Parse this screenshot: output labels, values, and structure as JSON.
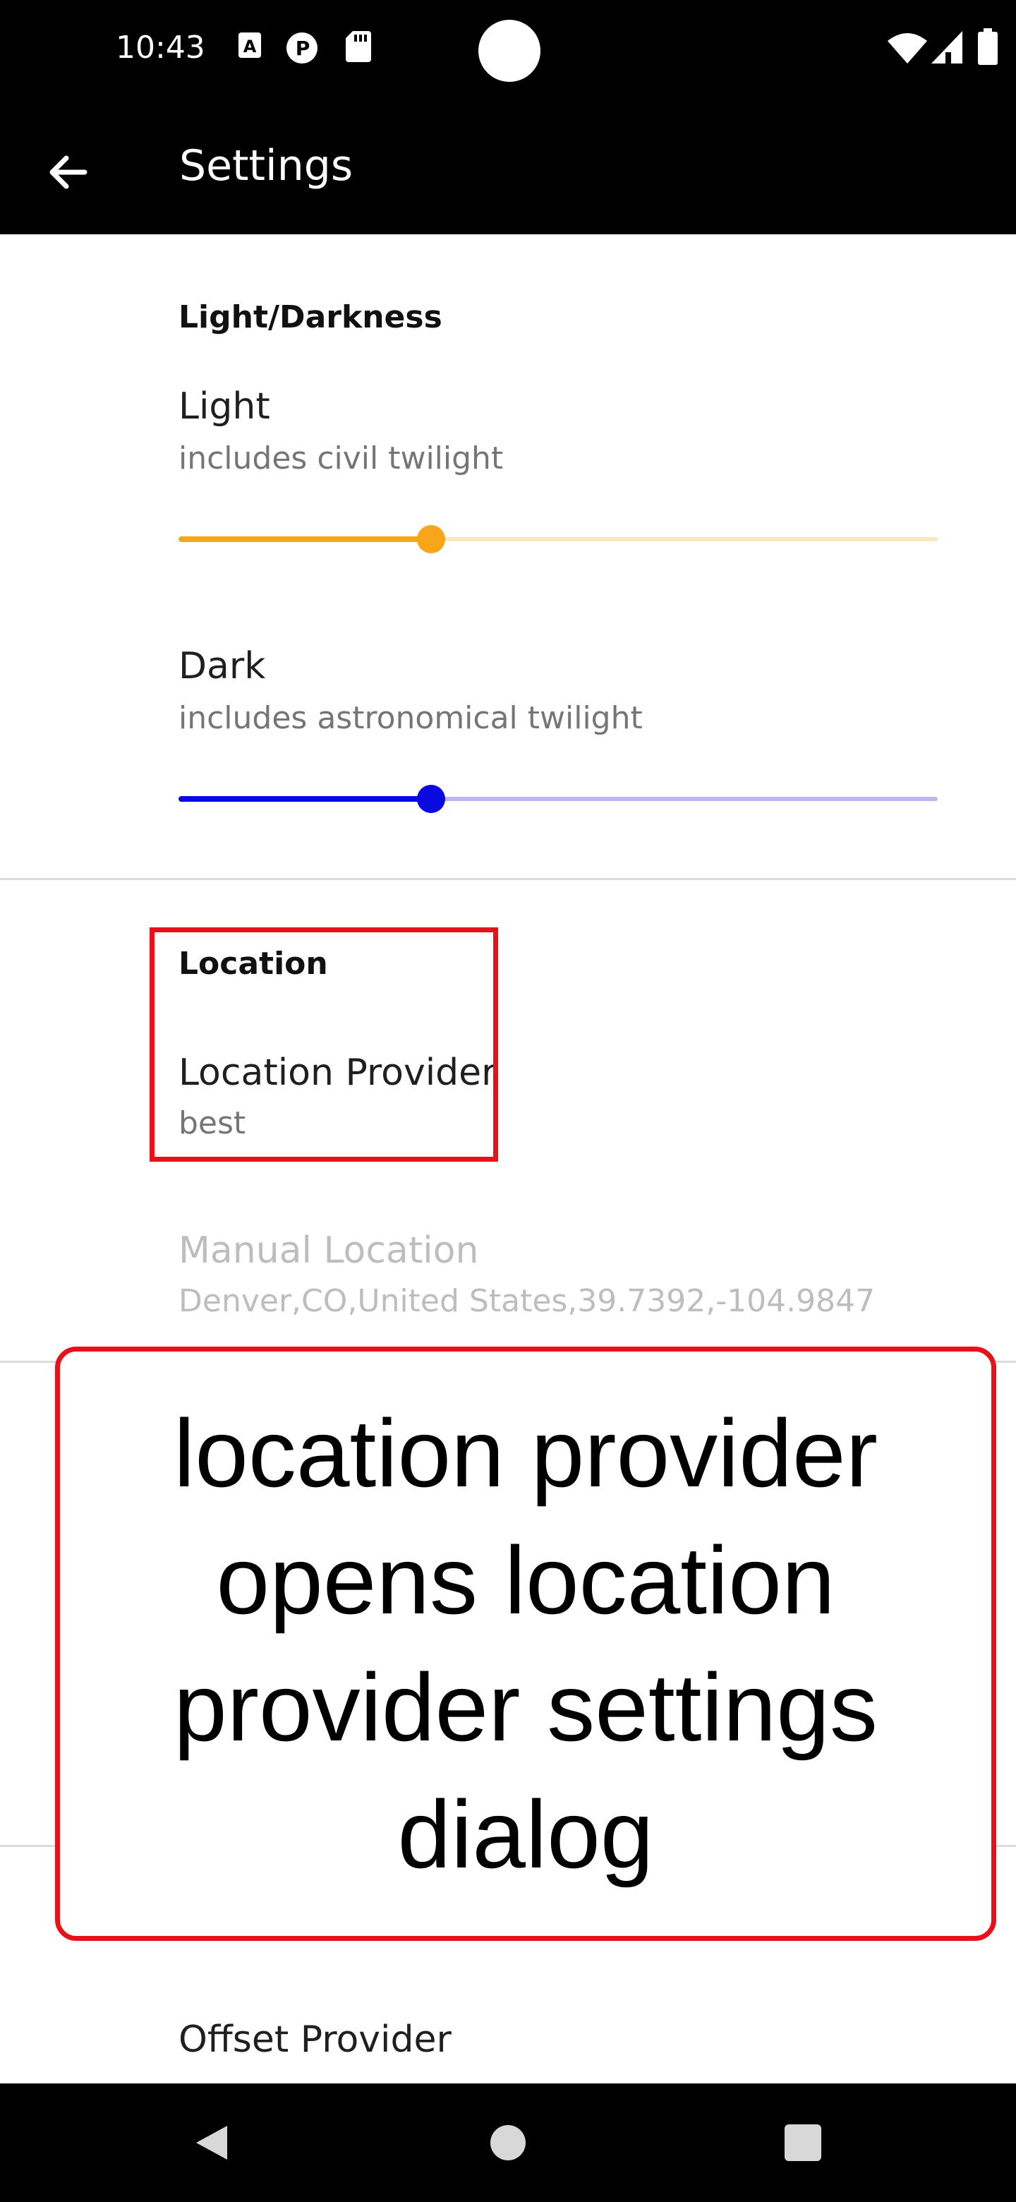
{
  "status_bar": {
    "time": "10:43",
    "left_icons": [
      "a-icon",
      "p-icon",
      "sd-card-icon"
    ],
    "right_icons": [
      "wifi-icon",
      "signal-icon",
      "battery-icon"
    ]
  },
  "app_bar": {
    "title": "Settings",
    "back_icon": "arrow-back-icon"
  },
  "sections": {
    "light_darkness": {
      "header": "Light/Darkness",
      "light": {
        "title": "Light",
        "summary": "includes civil twilight",
        "level": 0.333,
        "color": "#f9a51a",
        "track_color": "#fde6bd"
      },
      "dark": {
        "title": "Dark",
        "summary": "includes astronomical twilight",
        "level": 0.333,
        "color": "#0a0ae0",
        "track_color": "#b9b9f0"
      }
    },
    "location": {
      "header": "Location",
      "provider": {
        "title": "Location Provider",
        "summary": "best"
      },
      "manual": {
        "title": "Manual Location",
        "summary": "Denver,CO,United States,39.7392,-104.9847"
      }
    },
    "offset": {
      "title": "Offset Provider"
    }
  },
  "annotation": {
    "text": "location provider opens location provider settings dialog",
    "color": "#e8101a"
  },
  "nav_bar": {
    "icons": [
      "back-triangle-icon",
      "home-circle-icon",
      "recents-square-icon"
    ]
  }
}
